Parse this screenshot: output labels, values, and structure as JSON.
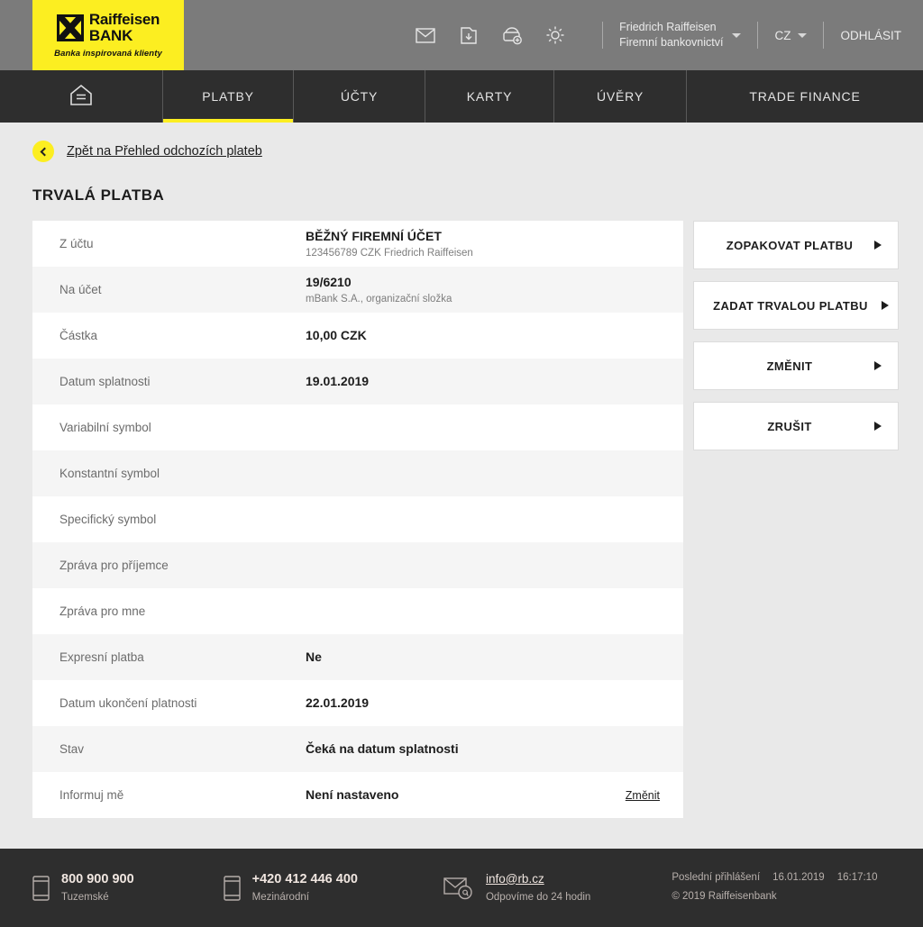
{
  "header": {
    "logo": {
      "line1": "Raiffeisen",
      "line2": "BANK",
      "claim": "Banka inspirovaná klienty"
    },
    "icons": [
      {
        "name": "mail-icon"
      },
      {
        "name": "download-folder-icon"
      },
      {
        "name": "add-purse-icon"
      },
      {
        "name": "gear-icon"
      }
    ],
    "user": {
      "name": "Friedrich Raiffeisen",
      "segment": "Firemní bankovnictví"
    },
    "language": "CZ",
    "logout": "ODHLÁSIT"
  },
  "nav": {
    "home_icon": "home-icon",
    "items": [
      {
        "label": "PLATBY",
        "active": true
      },
      {
        "label": "ÚČTY",
        "active": false
      },
      {
        "label": "KARTY",
        "active": false
      },
      {
        "label": "ÚVĚRY",
        "active": false
      },
      {
        "label": "TRADE FINANCE",
        "active": false
      }
    ]
  },
  "page": {
    "back_link": "Zpět na Přehled odchozích plateb",
    "title": "TRVALÁ PLATBA"
  },
  "detail": {
    "rows": [
      {
        "label": "Z účtu",
        "value": "BĚŽNÝ FIREMNÍ ÚČET",
        "sub": "123456789 CZK Friedrich Raiffeisen",
        "action": ""
      },
      {
        "label": "Na účet",
        "value": "19/6210",
        "sub": "mBank S.A., organizační složka",
        "action": ""
      },
      {
        "label": "Částka",
        "value": "10,00 CZK",
        "sub": "",
        "action": ""
      },
      {
        "label": "Datum splatnosti",
        "value": "19.01.2019",
        "sub": "",
        "action": ""
      },
      {
        "label": "Variabilní symbol",
        "value": "",
        "sub": "",
        "action": ""
      },
      {
        "label": "Konstantní symbol",
        "value": "",
        "sub": "",
        "action": ""
      },
      {
        "label": "Specifický symbol",
        "value": "",
        "sub": "",
        "action": ""
      },
      {
        "label": "Zpráva pro příjemce",
        "value": "",
        "sub": "",
        "action": ""
      },
      {
        "label": "Zpráva pro mne",
        "value": "",
        "sub": "",
        "action": ""
      },
      {
        "label": "Expresní platba",
        "value": "Ne",
        "sub": "",
        "action": ""
      },
      {
        "label": "Datum ukončení platnosti",
        "value": "22.01.2019",
        "sub": "",
        "action": ""
      },
      {
        "label": "Stav",
        "value": "Čeká na datum splatnosti",
        "sub": "",
        "action": ""
      },
      {
        "label": "Informuj mě",
        "value": "Není nastaveno",
        "sub": "",
        "action": "Změnit"
      }
    ]
  },
  "actions": [
    {
      "label": "ZOPAKOVAT PLATBU"
    },
    {
      "label": "ZADAT TRVALOU PLATBU"
    },
    {
      "label": "ZMĚNIT"
    },
    {
      "label": "ZRUŠIT"
    }
  ],
  "footer": {
    "phone_domestic": {
      "number": "800 900 900",
      "caption": "Tuzemské",
      "icon": "phone-icon"
    },
    "phone_international": {
      "number": "+420 412 446 400",
      "caption": "Mezinárodní",
      "icon": "phone-icon"
    },
    "email": {
      "address": "info@rb.cz",
      "caption": "Odpovíme do 24 hodin",
      "icon": "mail-at-icon"
    },
    "last_login_label": "Poslední přihlášení",
    "last_login_date": "16.01.2019",
    "last_login_time": "16:17:10",
    "copyright": "© 2019 Raiffeisenbank"
  },
  "colors": {
    "brand_yellow": "#fcee21",
    "header_gray": "#7b7b7b",
    "nav_dark": "#2e2e2e",
    "page_bg": "#e9e9e9"
  }
}
